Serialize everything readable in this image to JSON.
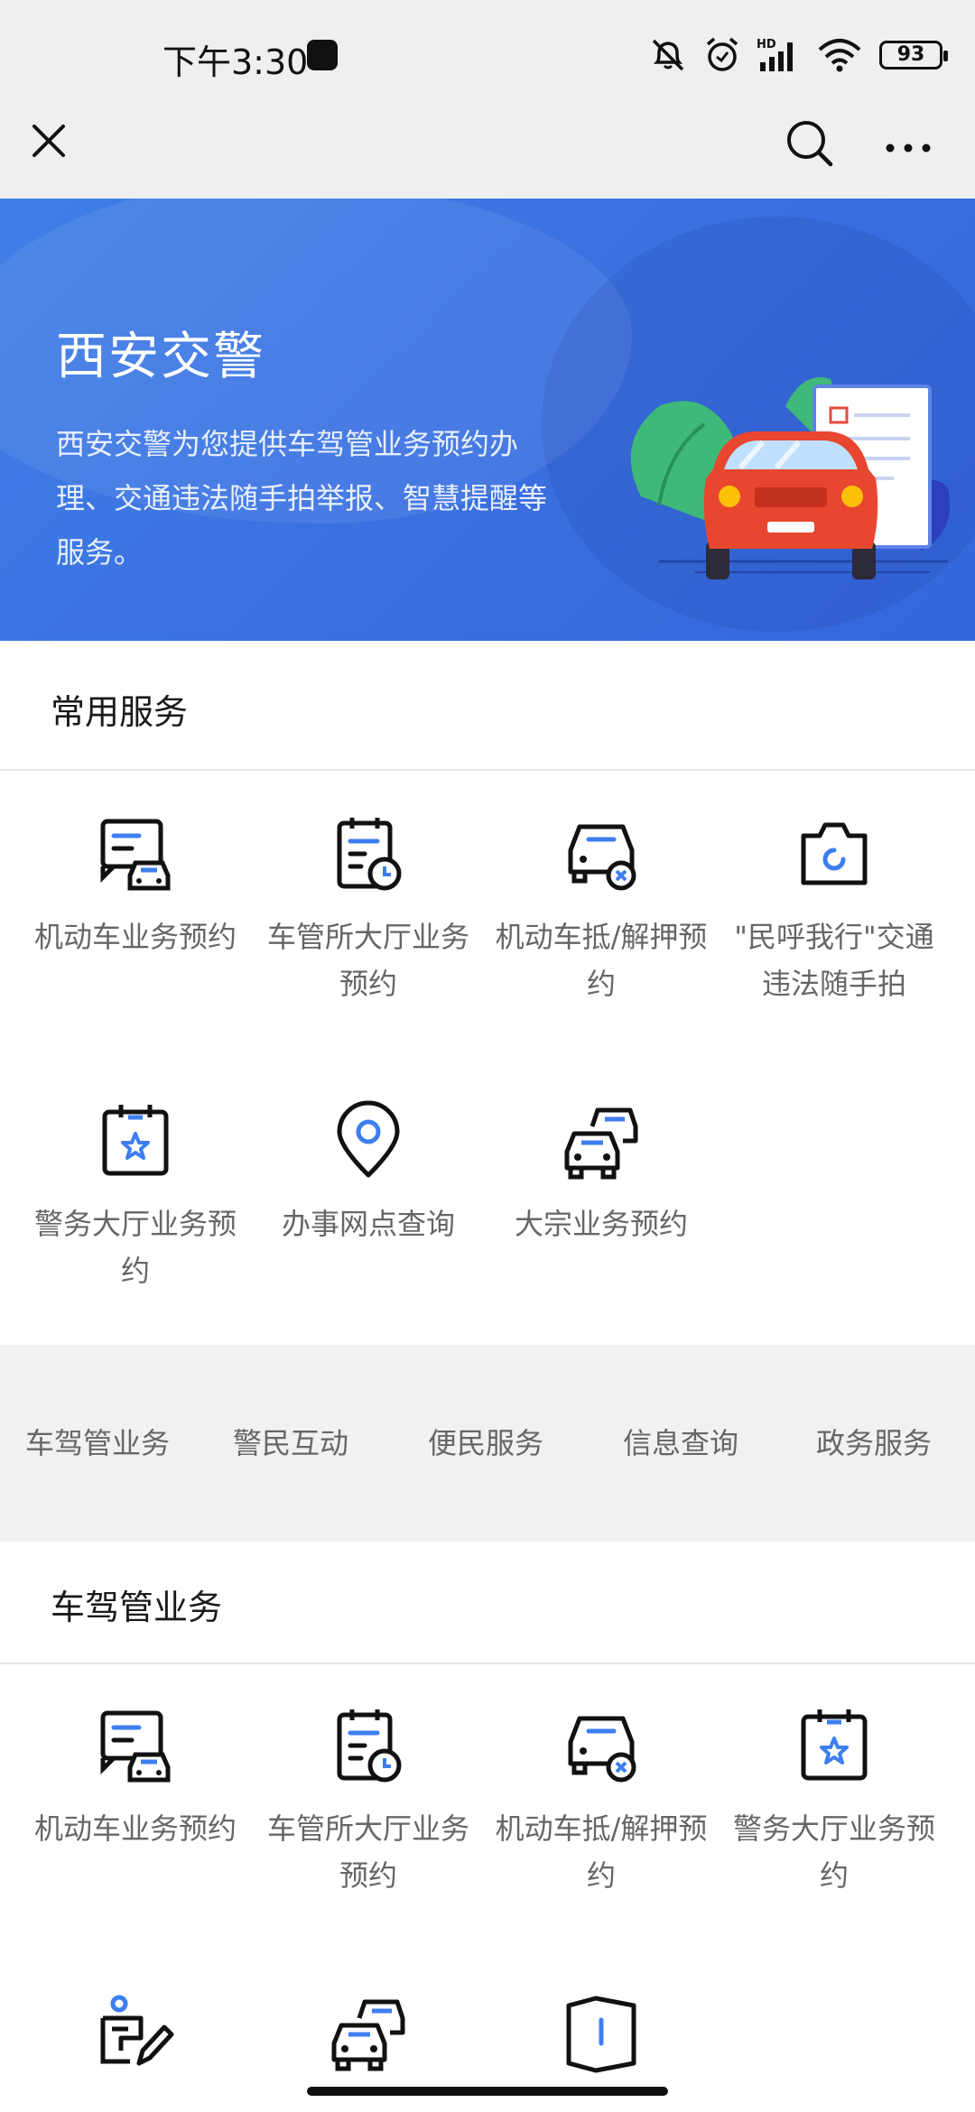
{
  "status_bar": {
    "time": "下午3:30",
    "battery": "93"
  },
  "hero": {
    "title": "西安交警",
    "description": "西安交警为您提供车驾管业务预约办理、交通违法随手拍举报、智慧提醒等服务。"
  },
  "common_services": {
    "title": "常用服务",
    "items": [
      {
        "label": "机动车业务预约",
        "icon": "car-doc-icon"
      },
      {
        "label": "车管所大厅业务预约",
        "icon": "clipboard-clock-icon"
      },
      {
        "label": "机动车抵/解押预约",
        "icon": "car-x-icon"
      },
      {
        "label": "\"民呼我行\"交通违法随手拍",
        "icon": "camera-icon"
      },
      {
        "label": "警务大厅业务预约",
        "icon": "clipboard-star-icon"
      },
      {
        "label": "办事网点查询",
        "icon": "location-pin-icon"
      },
      {
        "label": "大宗业务预约",
        "icon": "two-cars-icon"
      }
    ]
  },
  "tabs": [
    "车驾管业务",
    "警民互动",
    "便民服务",
    "信息查询",
    "政务服务"
  ],
  "vehicle_services": {
    "title": "车驾管业务",
    "items": [
      {
        "label": "机动车业务预约",
        "icon": "car-doc-icon"
      },
      {
        "label": "车管所大厅业务预约",
        "icon": "clipboard-clock-icon"
      },
      {
        "label": "机动车抵/解押预约",
        "icon": "car-x-icon"
      },
      {
        "label": "警务大厅业务预约",
        "icon": "clipboard-star-icon"
      },
      {
        "label": "",
        "icon": "person-pen-icon"
      },
      {
        "label": "",
        "icon": "two-cars-icon"
      },
      {
        "label": "",
        "icon": "book-icon"
      }
    ]
  },
  "colors": {
    "hero_blue": "#3a6fe0",
    "icon_stroke": "#111111",
    "icon_accent": "#3d7ef0"
  }
}
